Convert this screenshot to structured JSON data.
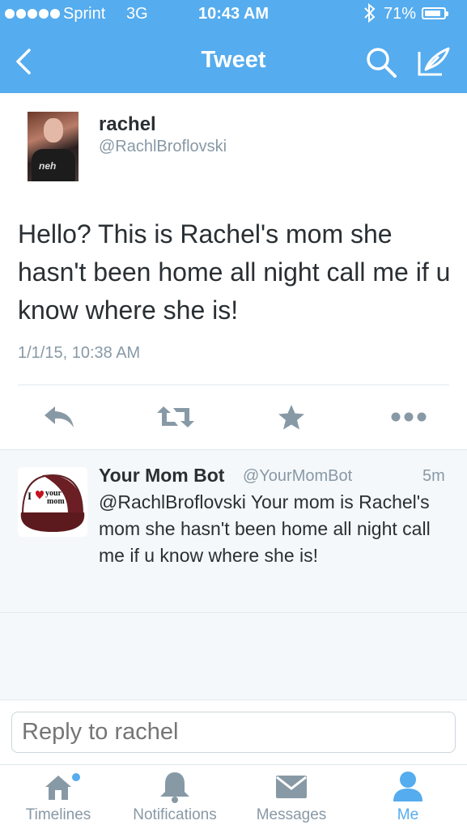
{
  "status_bar": {
    "carrier": "Sprint",
    "network": "3G",
    "time": "10:43 AM",
    "battery_pct": "71%",
    "battery_level": 0.71
  },
  "nav": {
    "title": "Tweet",
    "back_icon": "chevron-left-icon",
    "search_icon": "search-icon",
    "compose_icon": "compose-icon"
  },
  "tweet": {
    "name": "rachel",
    "handle": "@RachlBroflovski",
    "text": "Hello? This is Rachel's mom she hasn't been home all night call me if u know where she is!",
    "date": "1/1/15, 10:38 AM",
    "actions": [
      "reply-icon",
      "retweet-icon",
      "favorite-icon",
      "more-icon"
    ]
  },
  "reply": {
    "name": "Your Mom Bot",
    "handle": "@YourMomBot",
    "time": "5m",
    "text": "@RachlBroflovski Your mom is Rachel's mom she hasn't been home all night call me if u know where she is!",
    "avatar_text": "I ♥ your mom"
  },
  "compose": {
    "placeholder": "Reply to rachel"
  },
  "tabs": [
    {
      "label": "Timelines",
      "icon": "home-icon"
    },
    {
      "label": "Notifications",
      "icon": "bell-icon"
    },
    {
      "label": "Messages",
      "icon": "envelope-icon"
    },
    {
      "label": "Me",
      "icon": "person-icon"
    }
  ],
  "colors": {
    "accent": "#55acee",
    "text": "#292f33",
    "muted": "#8899a6"
  }
}
